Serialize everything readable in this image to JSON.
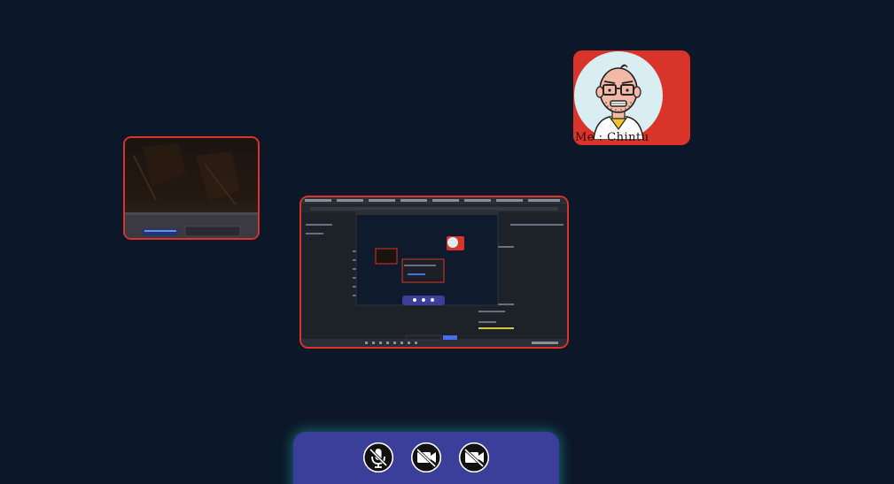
{
  "self_tile": {
    "label": "Me : Chintu"
  },
  "controls": {
    "icons": [
      "mic-off-icon",
      "camera-off-icon",
      "screen-share-off-icon"
    ]
  },
  "colors": {
    "background": "#0c1727",
    "tile_border": "#d9342a",
    "control_bar": "#3b3f9a",
    "glow": "#28bec8"
  }
}
